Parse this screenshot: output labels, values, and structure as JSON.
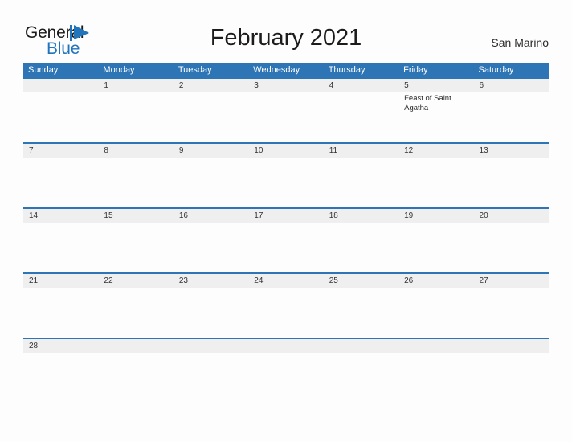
{
  "logo": {
    "word1": "General",
    "word2": "Blue",
    "flag_icon": "blue-flag-triangle-icon",
    "blue": "#1f74bd"
  },
  "header": {
    "title": "February 2021",
    "country": "San Marino"
  },
  "colors": {
    "header_blue": "#2e75b6",
    "row_divider_blue": "#2e75b6",
    "date_band_gray": "#efefef",
    "page_background": "#fdfdfd"
  },
  "calendar": {
    "month": "February",
    "year": "2021",
    "weekday_headers": [
      "Sunday",
      "Monday",
      "Tuesday",
      "Wednesday",
      "Thursday",
      "Friday",
      "Saturday"
    ],
    "weeks": [
      {
        "days": [
          {
            "date": "",
            "event": ""
          },
          {
            "date": "1",
            "event": ""
          },
          {
            "date": "2",
            "event": ""
          },
          {
            "date": "3",
            "event": ""
          },
          {
            "date": "4",
            "event": ""
          },
          {
            "date": "5",
            "event": "Feast of Saint Agatha"
          },
          {
            "date": "6",
            "event": ""
          }
        ]
      },
      {
        "days": [
          {
            "date": "7",
            "event": ""
          },
          {
            "date": "8",
            "event": ""
          },
          {
            "date": "9",
            "event": ""
          },
          {
            "date": "10",
            "event": ""
          },
          {
            "date": "11",
            "event": ""
          },
          {
            "date": "12",
            "event": ""
          },
          {
            "date": "13",
            "event": ""
          }
        ]
      },
      {
        "days": [
          {
            "date": "14",
            "event": ""
          },
          {
            "date": "15",
            "event": ""
          },
          {
            "date": "16",
            "event": ""
          },
          {
            "date": "17",
            "event": ""
          },
          {
            "date": "18",
            "event": ""
          },
          {
            "date": "19",
            "event": ""
          },
          {
            "date": "20",
            "event": ""
          }
        ]
      },
      {
        "days": [
          {
            "date": "21",
            "event": ""
          },
          {
            "date": "22",
            "event": ""
          },
          {
            "date": "23",
            "event": ""
          },
          {
            "date": "24",
            "event": ""
          },
          {
            "date": "25",
            "event": ""
          },
          {
            "date": "26",
            "event": ""
          },
          {
            "date": "27",
            "event": ""
          }
        ]
      },
      {
        "days": [
          {
            "date": "28",
            "event": ""
          },
          {
            "date": "",
            "event": ""
          },
          {
            "date": "",
            "event": ""
          },
          {
            "date": "",
            "event": ""
          },
          {
            "date": "",
            "event": ""
          },
          {
            "date": "",
            "event": ""
          },
          {
            "date": "",
            "event": ""
          }
        ]
      }
    ]
  }
}
